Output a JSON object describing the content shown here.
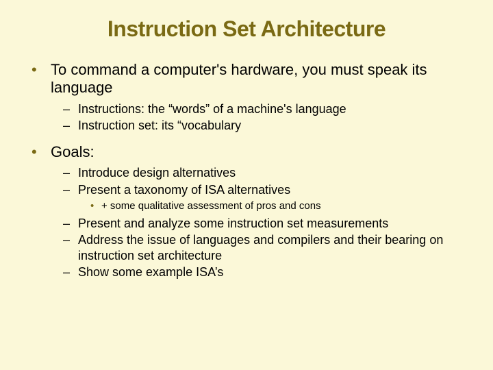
{
  "title": "Instruction Set Architecture",
  "bullets": [
    {
      "text": "To command a computer's hardware, you must speak its language",
      "children": [
        {
          "text": "Instructions: the “words” of a machine's language"
        },
        {
          "text": "Instruction set: its “vocabulary"
        }
      ]
    },
    {
      "text": "Goals:",
      "children": [
        {
          "text": "Introduce design alternatives"
        },
        {
          "text": "Present a taxonomy of ISA alternatives",
          "children": [
            {
              "text": "+ some qualitative assessment of pros and cons"
            }
          ]
        },
        {
          "text": "Present and analyze some instruction set measurements"
        },
        {
          "text": "Address the issue of languages and compilers and their bearing on instruction set architecture"
        },
        {
          "text": "Show some example ISA’s"
        }
      ]
    }
  ]
}
